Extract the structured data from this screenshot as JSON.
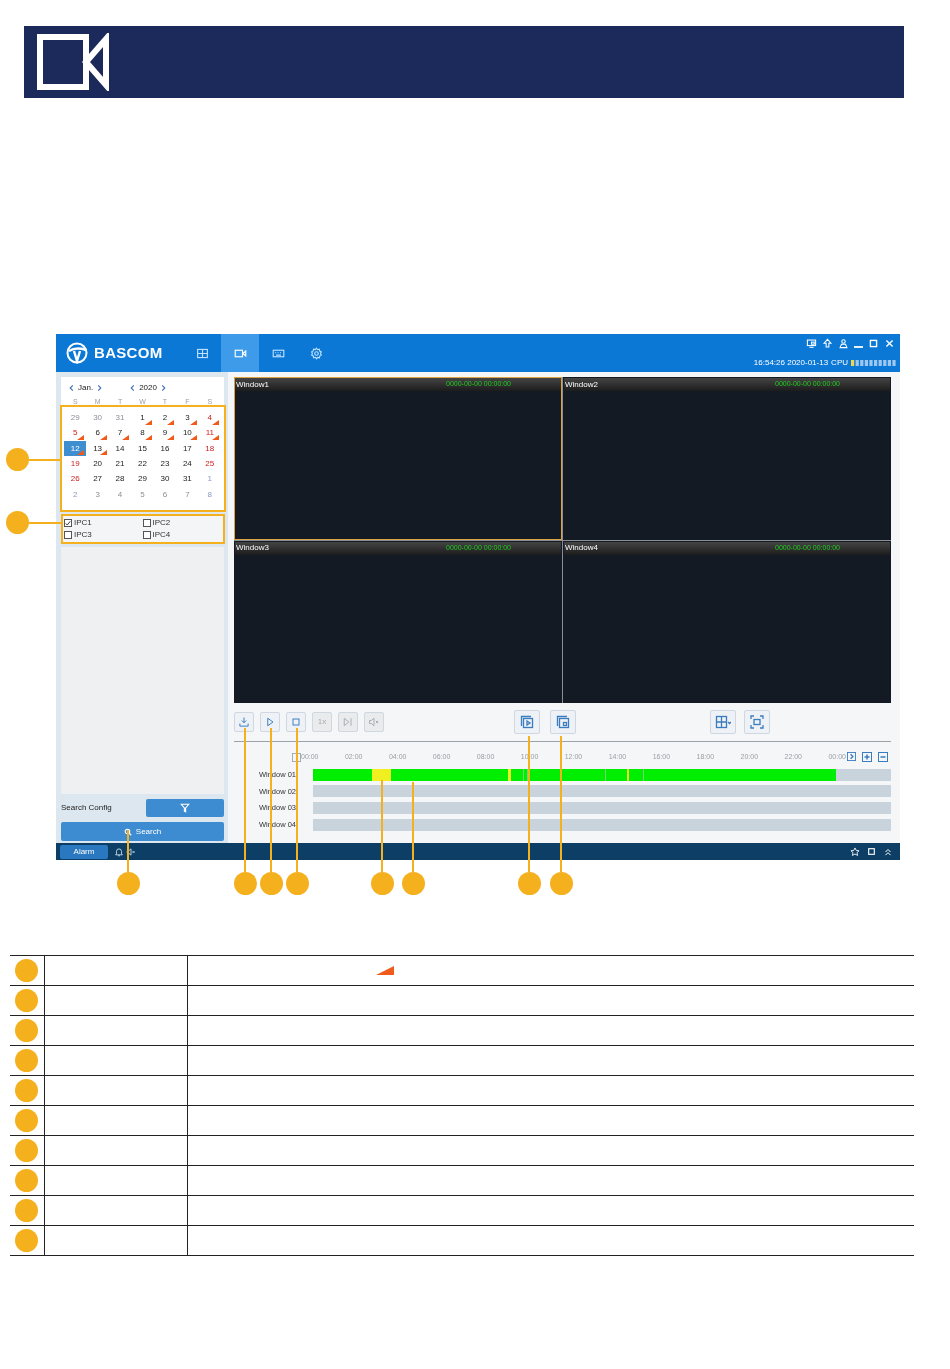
{
  "top_bar": {
    "brand": "BASCOM",
    "nav_tabs": [
      {
        "kind": "grid",
        "selected": false
      },
      {
        "kind": "camera",
        "selected": true
      },
      {
        "kind": "keyboard",
        "selected": false
      },
      {
        "kind": "settings",
        "selected": false
      }
    ],
    "window_controls": [
      {
        "kind": "cast"
      },
      {
        "kind": "upload"
      },
      {
        "kind": "user"
      },
      {
        "kind": "minimize"
      },
      {
        "kind": "maximize"
      },
      {
        "kind": "close"
      }
    ],
    "clock": "16:54:26 2020-01-13",
    "cpu_label": "CPU",
    "cpu": {
      "level": 0.1
    }
  },
  "calendar": {
    "month": "Jan.",
    "year": "2020",
    "weekdays": [
      "S",
      "M",
      "T",
      "W",
      "T",
      "F",
      "S"
    ],
    "days": [
      {
        "label": "29",
        "other_month": true,
        "weekend": false,
        "has_record": false,
        "selected": false
      },
      {
        "label": "30",
        "other_month": true,
        "weekend": false,
        "has_record": false,
        "selected": false
      },
      {
        "label": "31",
        "other_month": true,
        "weekend": false,
        "has_record": false,
        "selected": false
      },
      {
        "label": "1",
        "other_month": false,
        "weekend": false,
        "has_record": true,
        "selected": false
      },
      {
        "label": "2",
        "other_month": false,
        "weekend": false,
        "has_record": true,
        "selected": false
      },
      {
        "label": "3",
        "other_month": false,
        "weekend": false,
        "has_record": true,
        "selected": false
      },
      {
        "label": "4",
        "other_month": false,
        "weekend": true,
        "has_record": true,
        "selected": false
      },
      {
        "label": "5",
        "other_month": false,
        "weekend": true,
        "has_record": true,
        "selected": false
      },
      {
        "label": "6",
        "other_month": false,
        "weekend": false,
        "has_record": true,
        "selected": false
      },
      {
        "label": "7",
        "other_month": false,
        "weekend": false,
        "has_record": true,
        "selected": false
      },
      {
        "label": "8",
        "other_month": false,
        "weekend": false,
        "has_record": true,
        "selected": false
      },
      {
        "label": "9",
        "other_month": false,
        "weekend": false,
        "has_record": true,
        "selected": false
      },
      {
        "label": "10",
        "other_month": false,
        "weekend": false,
        "has_record": true,
        "selected": false
      },
      {
        "label": "11",
        "other_month": false,
        "weekend": true,
        "has_record": true,
        "selected": false
      },
      {
        "label": "12",
        "other_month": false,
        "weekend": true,
        "has_record": true,
        "selected": true
      },
      {
        "label": "13",
        "other_month": false,
        "weekend": false,
        "has_record": true,
        "selected": false
      },
      {
        "label": "14",
        "other_month": false,
        "weekend": false,
        "has_record": false,
        "selected": false
      },
      {
        "label": "15",
        "other_month": false,
        "weekend": false,
        "has_record": false,
        "selected": false
      },
      {
        "label": "16",
        "other_month": false,
        "weekend": false,
        "has_record": false,
        "selected": false
      },
      {
        "label": "17",
        "other_month": false,
        "weekend": false,
        "has_record": false,
        "selected": false
      },
      {
        "label": "18",
        "other_month": false,
        "weekend": true,
        "has_record": false,
        "selected": false
      },
      {
        "label": "19",
        "other_month": false,
        "weekend": true,
        "has_record": false,
        "selected": false
      },
      {
        "label": "20",
        "other_month": false,
        "weekend": false,
        "has_record": false,
        "selected": false
      },
      {
        "label": "21",
        "other_month": false,
        "weekend": false,
        "has_record": false,
        "selected": false
      },
      {
        "label": "22",
        "other_month": false,
        "weekend": false,
        "has_record": false,
        "selected": false
      },
      {
        "label": "23",
        "other_month": false,
        "weekend": false,
        "has_record": false,
        "selected": false
      },
      {
        "label": "24",
        "other_month": false,
        "weekend": false,
        "has_record": false,
        "selected": false
      },
      {
        "label": "25",
        "other_month": false,
        "weekend": true,
        "has_record": false,
        "selected": false
      },
      {
        "label": "26",
        "other_month": false,
        "weekend": true,
        "has_record": false,
        "selected": false
      },
      {
        "label": "27",
        "other_month": false,
        "weekend": false,
        "has_record": false,
        "selected": false
      },
      {
        "label": "28",
        "other_month": false,
        "weekend": false,
        "has_record": false,
        "selected": false
      },
      {
        "label": "29",
        "other_month": false,
        "weekend": false,
        "has_record": false,
        "selected": false
      },
      {
        "label": "30",
        "other_month": false,
        "weekend": false,
        "has_record": false,
        "selected": false
      },
      {
        "label": "31",
        "other_month": false,
        "weekend": false,
        "has_record": false,
        "selected": false
      },
      {
        "label": "1",
        "other_month": true,
        "weekend": true,
        "has_record": false,
        "selected": false
      },
      {
        "label": "2",
        "other_month": true,
        "weekend": true,
        "has_record": false,
        "selected": false
      },
      {
        "label": "3",
        "other_month": true,
        "weekend": false,
        "has_record": false,
        "selected": false
      },
      {
        "label": "4",
        "other_month": true,
        "weekend": false,
        "has_record": false,
        "selected": false
      },
      {
        "label": "5",
        "other_month": true,
        "weekend": false,
        "has_record": false,
        "selected": false
      },
      {
        "label": "6",
        "other_month": true,
        "weekend": false,
        "has_record": false,
        "selected": false
      },
      {
        "label": "7",
        "other_month": true,
        "weekend": false,
        "has_record": false,
        "selected": false
      },
      {
        "label": "8",
        "other_month": true,
        "weekend": true,
        "has_record": false,
        "selected": false
      }
    ]
  },
  "cameras": [
    {
      "label": "IPC1",
      "checked": true
    },
    {
      "label": "IPC2",
      "checked": false
    },
    {
      "label": "IPC3",
      "checked": false
    },
    {
      "label": "IPC4",
      "checked": false
    }
  ],
  "search_panel": {
    "config_label": "Search Config",
    "search_button": "Search"
  },
  "video_windows": [
    {
      "title": "Window1",
      "timestamp": "0000-00-00 00:00:00",
      "selected": true
    },
    {
      "title": "Window2",
      "timestamp": "0000-00-00 00:00:00",
      "selected": false
    },
    {
      "title": "Window3",
      "timestamp": "0000-00-00 00:00:00",
      "selected": false
    },
    {
      "title": "Window4",
      "timestamp": "0000-00-00 00:00:00",
      "selected": false
    }
  ],
  "playback_controls": [
    {
      "kind": "download",
      "disabled": false
    },
    {
      "kind": "play",
      "disabled": false
    },
    {
      "kind": "stop",
      "disabled": false
    },
    {
      "kind": "speed",
      "label": "1x",
      "disabled": true
    },
    {
      "kind": "step",
      "disabled": true
    },
    {
      "kind": "mute",
      "disabled": true
    }
  ],
  "sync_controls": [
    {
      "kind": "sync-play"
    },
    {
      "kind": "sync-stop"
    }
  ],
  "view_controls": [
    {
      "kind": "layout"
    },
    {
      "kind": "fullscreen"
    }
  ],
  "timeline": {
    "ticks": [
      "00:00",
      "02:00",
      "04:00",
      "06:00",
      "08:00",
      "10:00",
      "12:00",
      "14:00",
      "16:00",
      "18:00",
      "20:00",
      "22:00",
      "00:00"
    ],
    "rows": [
      {
        "label": "Window 01",
        "has_recording": true
      },
      {
        "label": "Window 02",
        "has_recording": false
      },
      {
        "label": "Window 03",
        "has_recording": false
      },
      {
        "label": "Window 04",
        "has_recording": false
      }
    ]
  },
  "status_bar": {
    "alarm_button": "Alarm"
  },
  "legend_rows": [
    {
      "kind": "record-flag"
    },
    {
      "kind": "plain"
    },
    {
      "kind": "plain"
    },
    {
      "kind": "plain"
    },
    {
      "kind": "plain"
    },
    {
      "kind": "plain"
    },
    {
      "kind": "plain"
    },
    {
      "kind": "plain"
    },
    {
      "kind": "plain"
    },
    {
      "kind": "plain"
    }
  ]
}
